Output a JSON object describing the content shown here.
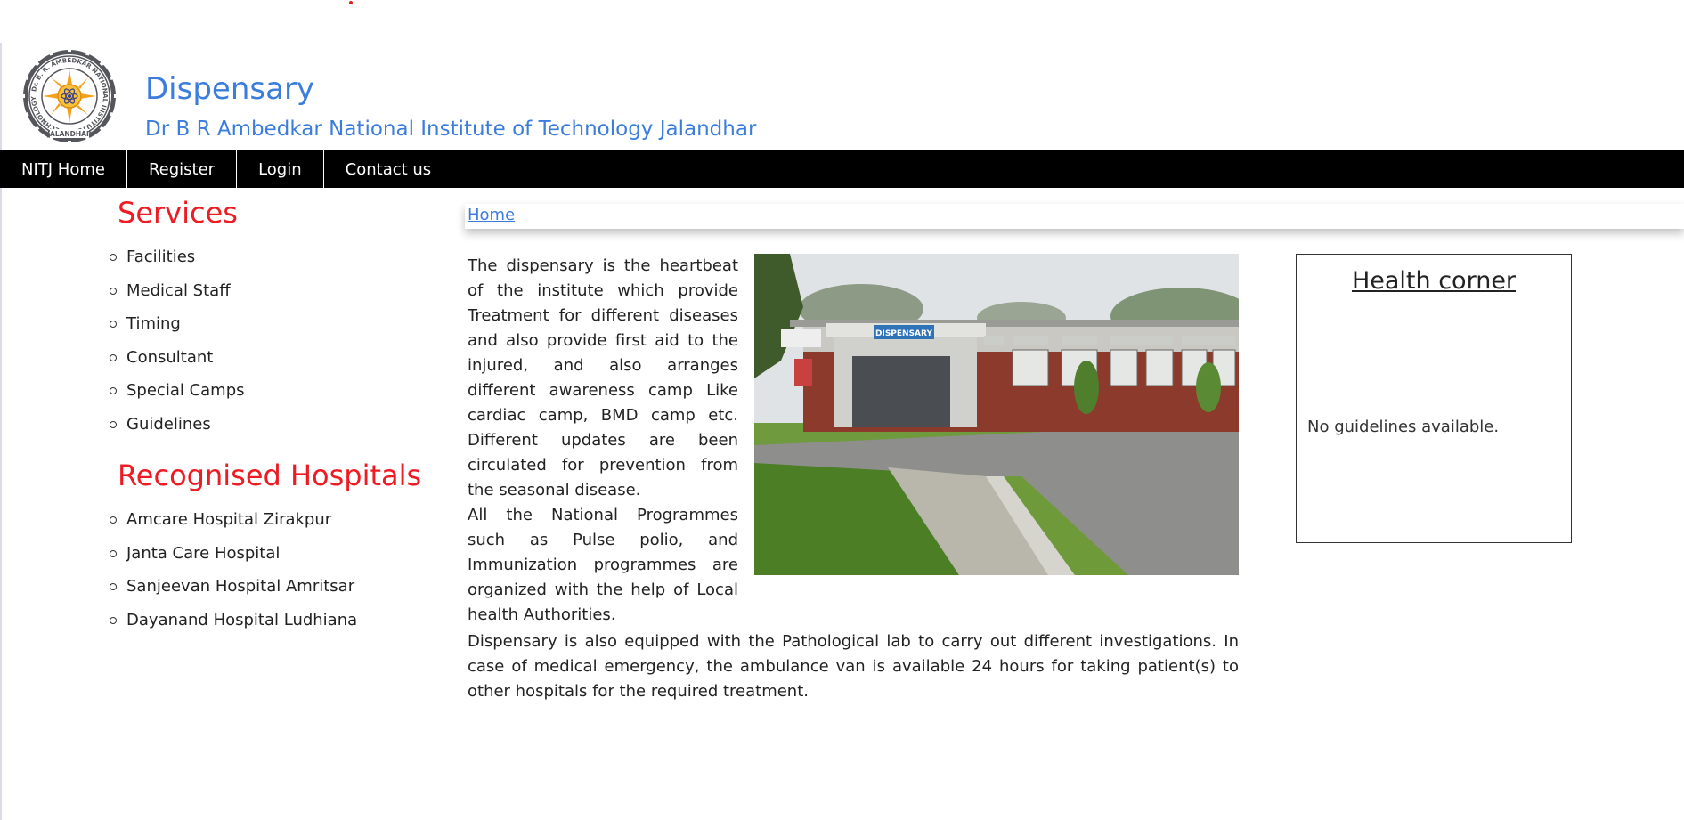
{
  "header": {
    "title": "Dispensary",
    "subtitle": "Dr B R Ambedkar National Institute of Technology Jalandhar",
    "logo_icon": "nitj-emblem-icon",
    "logo_ring_text": "Dr. B. R. AMBEDKAR NATIONAL INSTITUTE OF TECHNOLOGY",
    "logo_bottom_text": "JALANDHAR"
  },
  "nav": {
    "items": [
      {
        "label": "NITJ Home"
      },
      {
        "label": "Register"
      },
      {
        "label": "Login"
      },
      {
        "label": "Contact us"
      }
    ]
  },
  "sidebar": {
    "services_heading": "Services",
    "services": [
      {
        "label": "Facilities"
      },
      {
        "label": "Medical Staff"
      },
      {
        "label": "Timing"
      },
      {
        "label": "Consultant"
      },
      {
        "label": "Special Camps"
      },
      {
        "label": "Guidelines"
      }
    ],
    "hospitals_heading": "Recognised Hospitals",
    "hospitals": [
      {
        "label": "Amcare Hospital Zirakpur"
      },
      {
        "label": "Janta Care Hospital"
      },
      {
        "label": "Sanjeevan Hospital Amritsar"
      },
      {
        "label": "Dayanand Hospital Ludhiana"
      }
    ]
  },
  "breadcrumb": {
    "home_label": "Home"
  },
  "main": {
    "paragraph1": "The dispensary is the heartbeat of the institute which provide Treatment for different diseases and also provide first aid to the injured, and also arranges different awareness camp Like cardiac camp, BMD camp etc. Different updates are been circulated for prevention from the seasonal disease.",
    "paragraph2": "All the National Programmes such as Pulse polio, and Immunization programmes are organized with the help of Local health Authorities.",
    "paragraph3": "Dispensary is also equipped with the Pathological lab to carry out different investigations. In case of medical emergency, the ambulance van is available 24 hours for taking patient(s) to other hospitals for the required treatment.",
    "photo_sign": "DISPENSARY"
  },
  "health_corner": {
    "title": "Health corner",
    "empty_text": "No guidelines available."
  },
  "colors": {
    "brand_blue": "#3b7ddd",
    "heading_red": "#ed1c24",
    "navbar_bg": "#000000"
  }
}
